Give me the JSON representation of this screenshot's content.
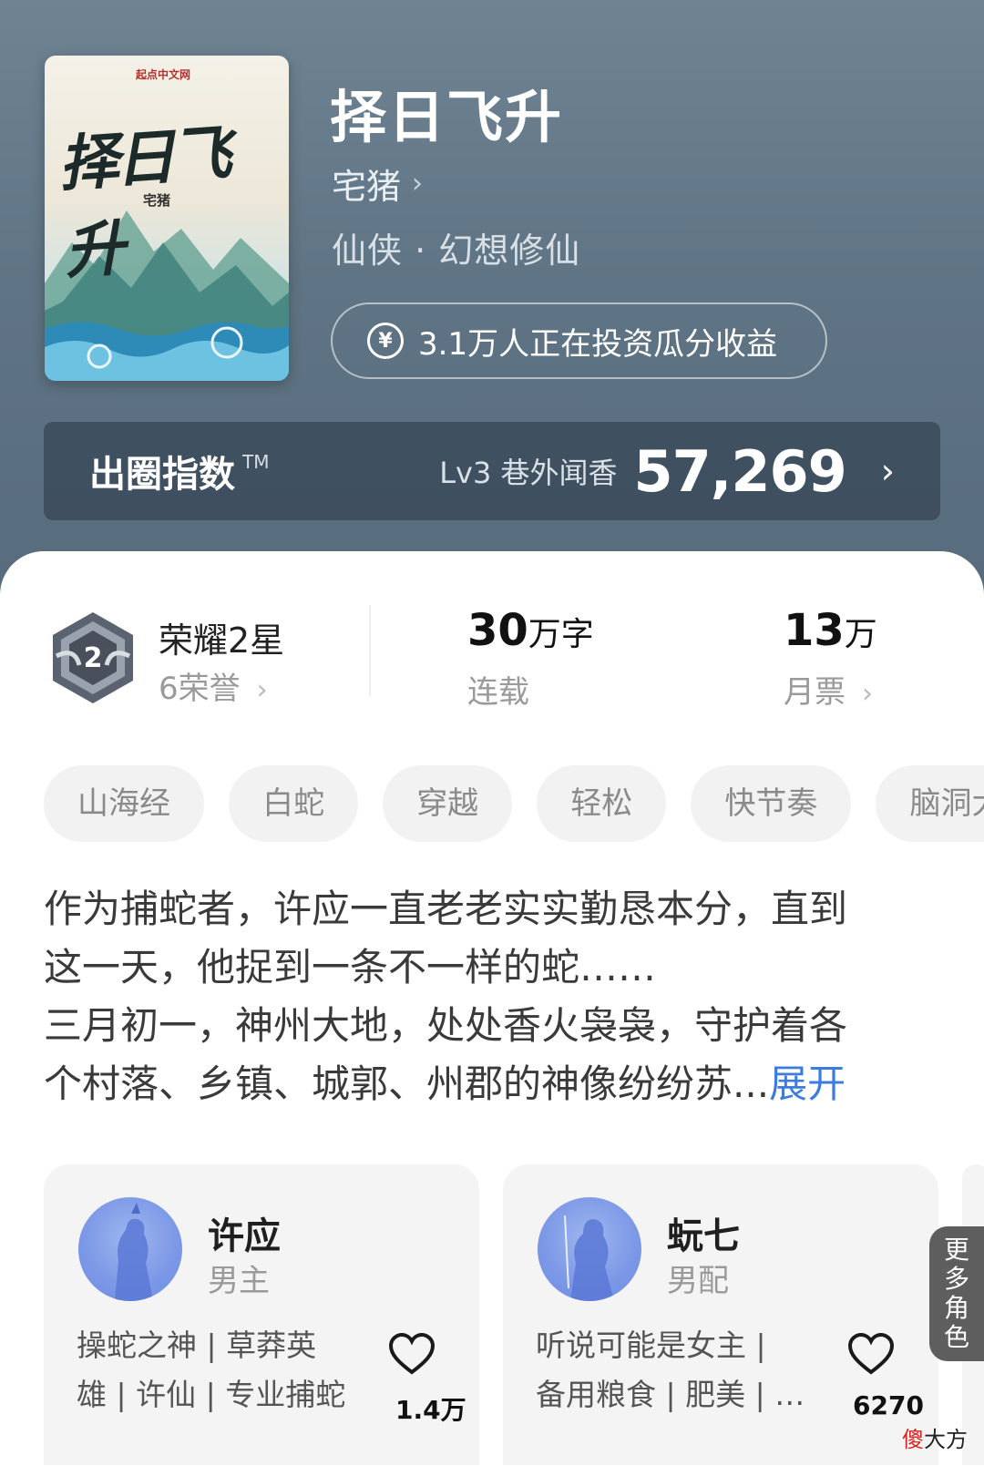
{
  "book": {
    "cover": {
      "publisher": "起点中文网",
      "title": "择日飞升",
      "author": "宅猪"
    },
    "title": "择日飞升",
    "author": "宅猪",
    "genre": "仙侠 · 幻想修仙",
    "invest_text": "3.1万人正在投资瓜分收益"
  },
  "index_bar": {
    "title": "出圈指数",
    "tm": "TM",
    "level": "Lv3 巷外闻香",
    "score": "57,269"
  },
  "stats": {
    "honor_title": "荣耀2星",
    "honor_sub": "6荣誉",
    "honor_badge_level": "2",
    "words_value": "30",
    "words_unit": "万字",
    "words_label": "连载",
    "ticket_value": "13",
    "ticket_unit": "万",
    "ticket_label": "月票"
  },
  "tags": [
    "山海经",
    "白蛇",
    "穿越",
    "轻松",
    "快节奏",
    "脑洞大"
  ],
  "description": {
    "lines": [
      "作为捕蛇者，许应一直老老实实勤恳本分，直到",
      "这一天，他捉到一条不一样的蛇……",
      "三月初一，神州大地，处处香火袅袅，守护着各",
      "个村落、乡镇、城郭、州郡的神像纷纷苏..."
    ],
    "expand_label": "展开"
  },
  "characters": [
    {
      "name": "许应",
      "role": "男主",
      "desc_line1": "操蛇之神 | 草莽英",
      "desc_line2": "雄 | 许仙 | 专业捕蛇",
      "likes": "1.4万"
    },
    {
      "name": "蚖七",
      "role": "男配",
      "desc_line1": "听说可能是女主 |",
      "desc_line2": "备用粮食 | 肥美 | …",
      "likes": "6270"
    }
  ],
  "more_roles_label": "更多角色",
  "watermark": {
    "first": "傻",
    "rest": "大方"
  },
  "colors": {
    "hero_bg": "#5f7484",
    "link_blue": "#3c7be0",
    "tag_bg": "#f2f2f2",
    "card_bg": "#f4f4f4"
  },
  "icons": [
    "chevron-right-icon",
    "yen-coin-icon",
    "honor-badge-icon",
    "heart-icon"
  ]
}
